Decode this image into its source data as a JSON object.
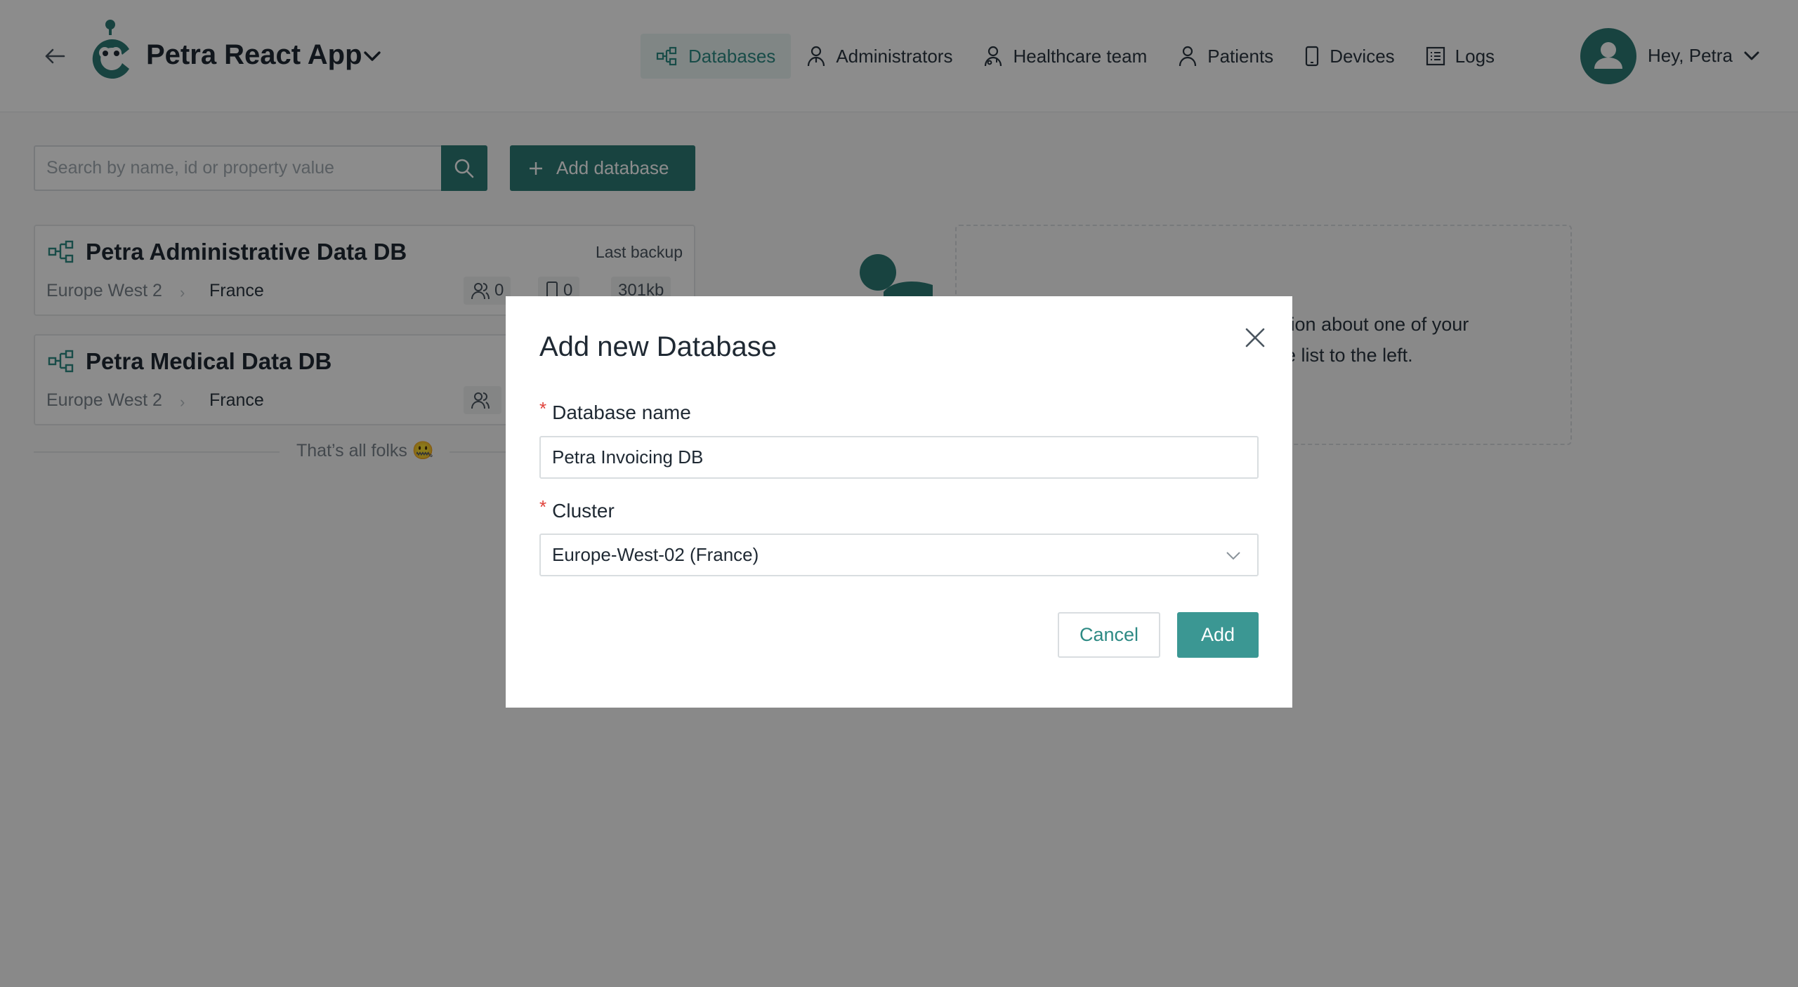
{
  "header": {
    "app_name": "Petra React App",
    "nav": [
      {
        "label": "Databases",
        "icon": "database-icon",
        "active": true
      },
      {
        "label": "Administrators",
        "icon": "administrator-icon",
        "active": false
      },
      {
        "label": "Healthcare team",
        "icon": "healthcare-team-icon",
        "active": false
      },
      {
        "label": "Patients",
        "icon": "patient-icon",
        "active": false
      },
      {
        "label": "Devices",
        "icon": "device-icon",
        "active": false
      },
      {
        "label": "Logs",
        "icon": "logs-icon",
        "active": false
      }
    ],
    "greeting": "Hey, Petra"
  },
  "search": {
    "placeholder": "Search by name, id or property value"
  },
  "toolbar": {
    "add_database_label": "Add database"
  },
  "databases": [
    {
      "name": "Petra Administrative Data DB",
      "last_backup_label": "Last backup",
      "region": "Europe West 2",
      "country": "France",
      "users": "0",
      "devices": "0",
      "size": "301kb"
    },
    {
      "name": "Petra Medical Data DB",
      "region": "Europe West 2",
      "country": "France"
    }
  ],
  "list_end_text": "That’s all folks 🤐",
  "placeholder": {
    "text_line1": "nation about one of your",
    "text_line2": " the list to the left."
  },
  "modal": {
    "title": "Add new Database",
    "name_label": "Database name",
    "name_value": "Petra Invoicing DB",
    "cluster_label": "Cluster",
    "cluster_value": "Europe-West-02 (France)",
    "cancel_label": "Cancel",
    "add_label": "Add"
  },
  "colors": {
    "primary": "#2d7a76",
    "primary_button": "#3b9793",
    "required": "#e0413a"
  }
}
